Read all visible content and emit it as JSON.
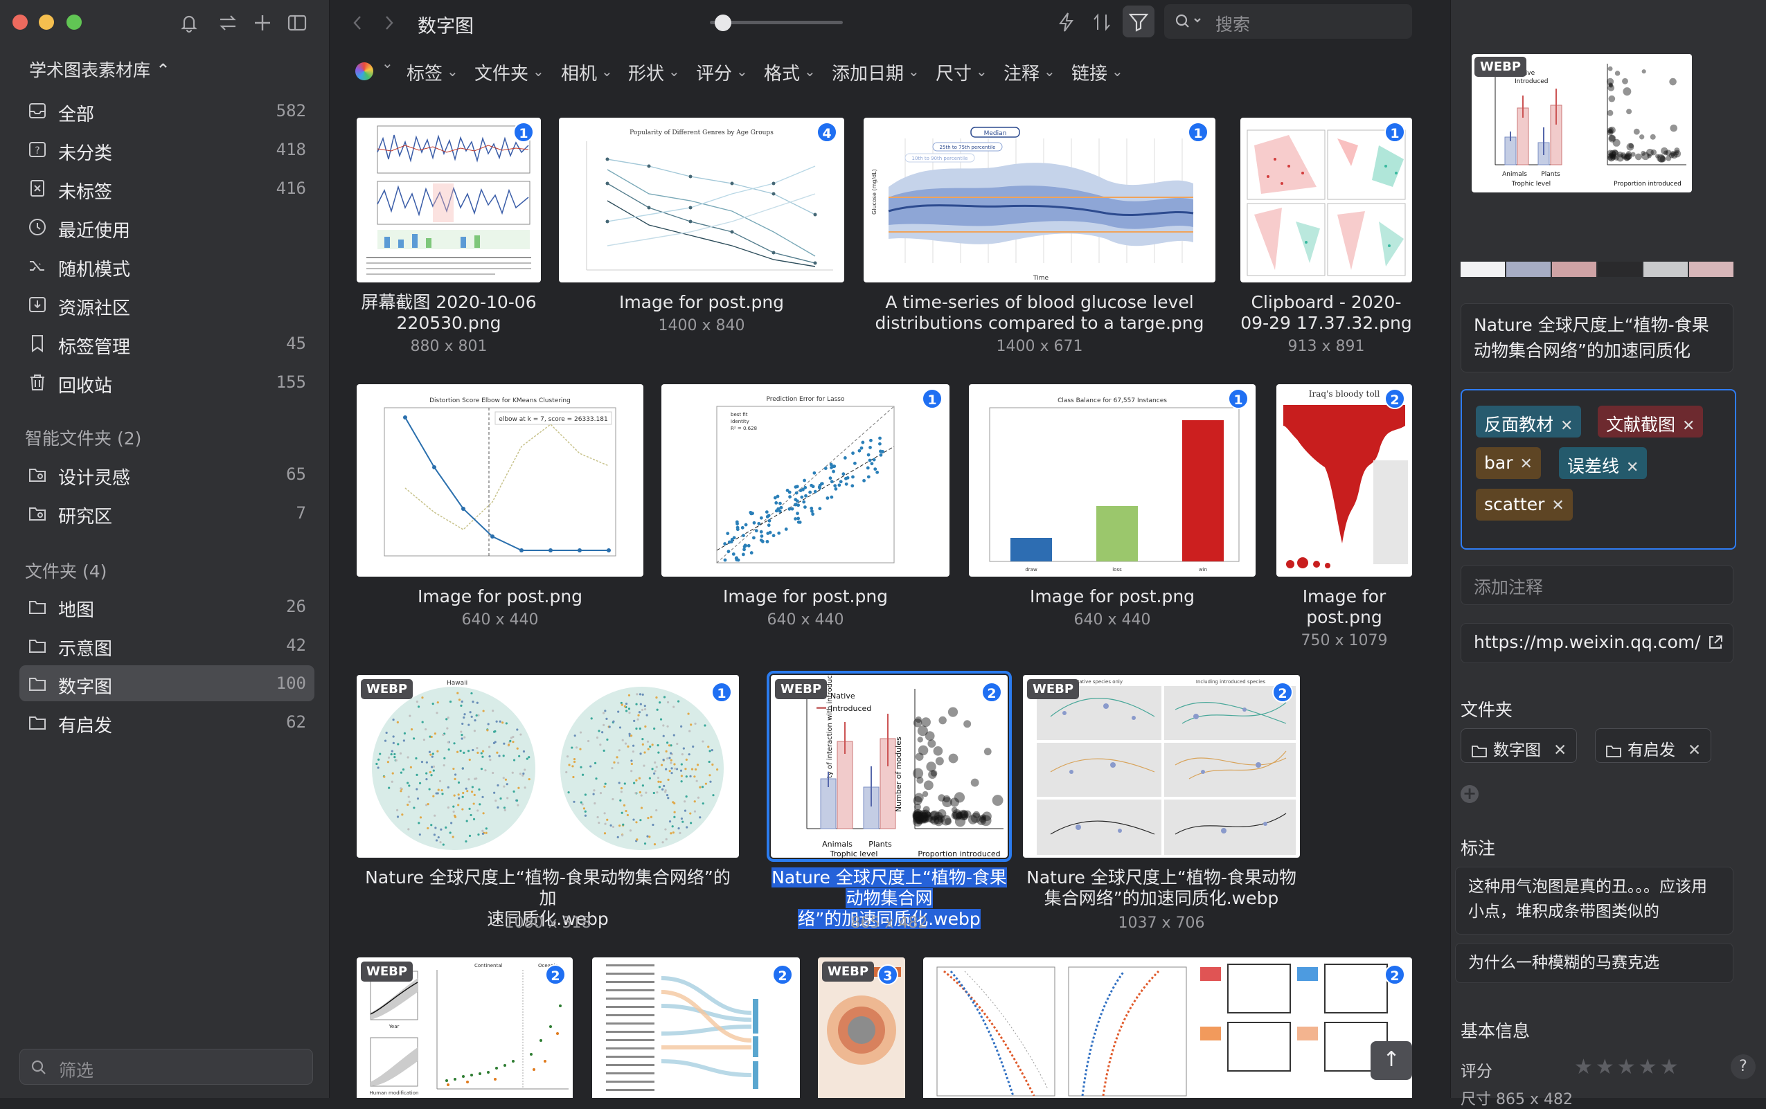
{
  "sidebar": {
    "library_title": "学术图表素材库 ⌃",
    "items": [
      {
        "label": "全部",
        "count": "582",
        "icon": "inbox-icon"
      },
      {
        "label": "未分类",
        "count": "418",
        "icon": "question-box-icon"
      },
      {
        "label": "未标签",
        "count": "416",
        "icon": "untagged-icon"
      },
      {
        "label": "最近使用",
        "count": "",
        "icon": "clock-icon"
      },
      {
        "label": "随机模式",
        "count": "",
        "icon": "shuffle-icon"
      },
      {
        "label": "资源社区",
        "count": "",
        "icon": "download-box-icon"
      },
      {
        "label": "标签管理",
        "count": "45",
        "icon": "bookmark-icon"
      },
      {
        "label": "回收站",
        "count": "155",
        "icon": "trash-icon"
      }
    ],
    "smart_header": "智能文件夹 (2)",
    "smart_folders": [
      {
        "label": "设计灵感",
        "count": "65"
      },
      {
        "label": "研究区",
        "count": "7"
      }
    ],
    "folders_header": "文件夹 (4)",
    "folders": [
      {
        "label": "地图",
        "count": "26"
      },
      {
        "label": "示意图",
        "count": "42"
      },
      {
        "label": "数字图",
        "count": "100"
      },
      {
        "label": "有启发",
        "count": "62"
      }
    ],
    "filter_placeholder": "筛选"
  },
  "toolbar": {
    "breadcrumb": "数字图",
    "search_placeholder": "搜索"
  },
  "filters": [
    "标签",
    "文件夹",
    "相机",
    "形状",
    "评分",
    "格式",
    "添加日期",
    "尺寸",
    "注释",
    "链接"
  ],
  "cards": [
    {
      "caption": "屏幕截图 2020-10-06\n220530.png",
      "dims": "880 x 801",
      "badge": "1"
    },
    {
      "caption": "Image for post.png",
      "dims": "1400 x 840",
      "badge": "4"
    },
    {
      "caption": "A time-series of blood glucose level\ndistributions compared to a targe.png",
      "dims": "1400 x 671",
      "badge": "1"
    },
    {
      "caption": "Clipboard - 2020-\n09-29 17.37.32.png",
      "dims": "913 x 891",
      "badge": "1"
    },
    {
      "caption": "Image for post.png",
      "dims": "640 x 440",
      "badge": ""
    },
    {
      "caption": "Image for post.png",
      "dims": "640 x 440",
      "badge": "1"
    },
    {
      "caption": "Image for post.png",
      "dims": "640 x 440",
      "badge": "1"
    },
    {
      "caption": "Image for\npost.png",
      "dims": "750 x 1079",
      "badge": "2"
    },
    {
      "caption": "Nature 全球尺度上“植物-食果动物集合网络”的加\n速同质化.webp",
      "dims": "1080 x 518",
      "badge": "1",
      "webp": "WEBP"
    },
    {
      "caption": "Nature 全球尺度上“植物-食果动物集合网\n络”的加速同质化.webp",
      "dims": "865 x 482",
      "badge": "2",
      "webp": "WEBP"
    },
    {
      "caption": "Nature 全球尺度上“植物-食果动物\n集合网络”的加速同质化.webp",
      "dims": "1037 x 706",
      "badge": "2",
      "webp": "WEBP"
    },
    {
      "caption": "",
      "dims": "",
      "badge": "2",
      "webp": "WEBP"
    },
    {
      "caption": "",
      "dims": "",
      "badge": "2"
    },
    {
      "caption": "",
      "dims": "",
      "badge": "3",
      "webp": "WEBP"
    },
    {
      "caption": "",
      "dims": "",
      "badge": "2"
    }
  ],
  "thumb_text": {
    "genres_title": "Popularity of Different Genres by Age Groups",
    "glucose_median": "Median",
    "glucose_p25": "25th to 75th percentile",
    "glucose_p10": "10th to 90th percentile",
    "glucose_ylabel": "Glucose (mg/dL)",
    "glucose_xlabel": "Time",
    "elbow_title": "Distortion Score Elbow for KMeans Clustering",
    "elbow_legend": "elbow at k = 7, score = 26333.181",
    "lasso_title": "Prediction Error for Lasso",
    "lasso_fit": "best fit",
    "lasso_identity": "identity",
    "lasso_r2": "R² = 0.628",
    "class_title": "Class Balance for 67,557 Instances",
    "class_cats": [
      "draw",
      "loss",
      "win"
    ],
    "iraq_title": "Iraq's bloody toll",
    "hawaii": "Hawaii",
    "native": "Native",
    "introduced": "Introduced",
    "animals": "Animals",
    "plants": "Plants",
    "trophic": "Trophic level",
    "prop_intro": "Proportion introduced",
    "n_modules": "Number of modules",
    "prob_label": "Probability of interaction with introduced partner",
    "native_only": "Native species only",
    "incl_intro": "Including introduced species",
    "continental": "Continental",
    "oceanic": "Oceanic",
    "human_mod": "Human modification",
    "year": "Year"
  },
  "inspector": {
    "title": "Nature  全球尺度上“植物-食果动物集合网络”的加速同质化",
    "swatches": [
      "#f2f2f4",
      "#a7adc4",
      "#cfa3a5",
      "#2a2a2c",
      "#c9cacc",
      "#d7b6b9"
    ],
    "tags": [
      {
        "label": "反面教材",
        "color": "#275a6e"
      },
      {
        "label": "文献截图",
        "color": "#6d2a2f"
      },
      {
        "label": "bar",
        "color": "#5e4524"
      },
      {
        "label": "误差线",
        "color": "#245a6c"
      },
      {
        "label": "scatter",
        "color": "#5e4524"
      }
    ],
    "note_placeholder": "添加注释",
    "url": "https://mp.weixin.qq.com/",
    "folders_header": "文件夹",
    "folders": [
      "数字图",
      "有启发"
    ],
    "annotations_header": "标注",
    "annotations": [
      "这种用气泡图是真的丑。。。应该用小点，堆积成条带图类似的",
      "为什么一种模糊的马赛克选"
    ],
    "basic_header": "基本信息",
    "rating_label": "评分",
    "bottom_partial": "尺寸      865 x 482"
  }
}
